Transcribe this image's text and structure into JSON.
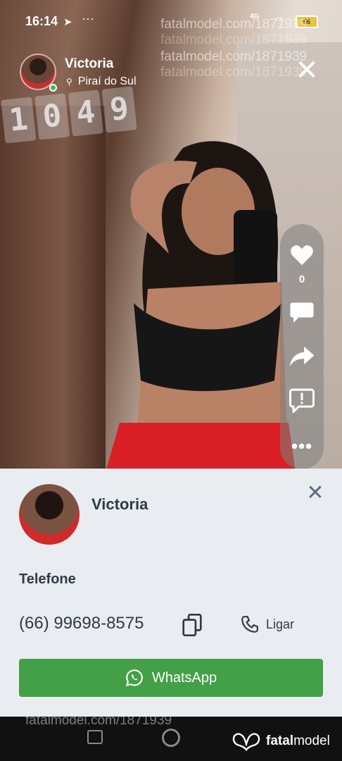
{
  "status_bar": {
    "time": "16:14",
    "network": "4G",
    "battery": "56"
  },
  "watermark": {
    "text": "fatalmodel.com/1871939"
  },
  "header": {
    "name": "Victoria",
    "location": "Piraí do Sul"
  },
  "clock_digits": [
    "1",
    "0",
    "4",
    "9"
  ],
  "actions": {
    "likes_count": "0"
  },
  "contact_sheet": {
    "name": "Victoria",
    "phone_label": "Telefone",
    "phone_number": "(66) 99698-8575",
    "call_label": "Ligar",
    "whatsapp_label": "WhatsApp"
  },
  "brand": {
    "part1": "fatal",
    "part2": "model"
  },
  "colors": {
    "whatsapp_green": "#43a047",
    "online_dot": "#3dbb4e",
    "sheet_bg": "#e9ecf0"
  }
}
